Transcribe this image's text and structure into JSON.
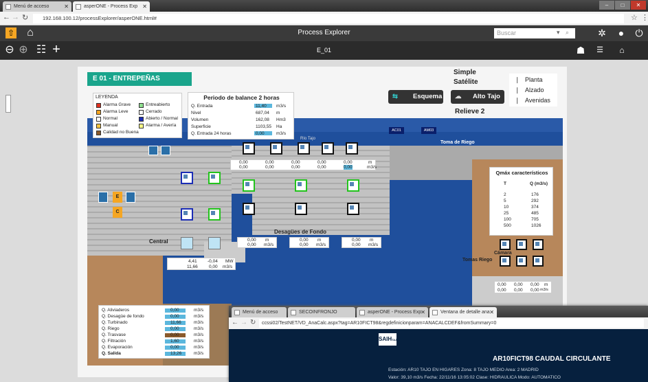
{
  "browser": {
    "tabs": [
      {
        "label": "Menú de acceso"
      },
      {
        "label": "asperONE - Process Exp"
      }
    ],
    "url": "192.168.100.12/processExplorer/asperONE.html#"
  },
  "app": {
    "title": "Process Explorer",
    "search_placeholder": "Buscar",
    "screen_name": "E_01"
  },
  "station": {
    "title": "E 01 - ENTREPEÑAS"
  },
  "legend": {
    "title": "LEYENDA",
    "items": [
      {
        "label": "Alarma Grave",
        "color": "#e03020"
      },
      {
        "label": "Entreabierto",
        "color": "#8fe08f"
      },
      {
        "label": "Alarma Leve",
        "color": "#f5a623"
      },
      {
        "label": "Cerrado",
        "color": "#ffffff"
      },
      {
        "label": "Normal",
        "color": "#ffffff"
      },
      {
        "label": "Abierto / Normal",
        "color": "#1b2db5"
      },
      {
        "label": "Manual",
        "color": "#f5c542"
      },
      {
        "label": "Alarma / Avería",
        "color": "#ffff88"
      },
      {
        "label": "Calidad no Buena",
        "color": "#8b5a2b"
      }
    ]
  },
  "balance": {
    "title": "Periodo de balance 2 horas",
    "rows": [
      {
        "label": "Q. Entrada",
        "value": "11,40",
        "unit": "m3/s",
        "bar": true
      },
      {
        "label": "Nivel",
        "value": "687,04",
        "unit": "m"
      },
      {
        "label": "Volumen",
        "value": "162,08",
        "unit": "Hm3"
      },
      {
        "label": "Superficie",
        "value": "1103,55",
        "unit": "Ha"
      },
      {
        "label": "Q. Entrada 24 horas",
        "value": "0,00",
        "unit": "m3/s",
        "bar": true
      }
    ]
  },
  "views": {
    "simple": "Simple",
    "satelite": "Satélite",
    "esquema": "Esquema",
    "alto_tajo": "Alto Tajo",
    "relieve": "Relieve 2"
  },
  "layers": {
    "planta": "Planta",
    "alzado": "Alzado",
    "avenidas": "Avenidas"
  },
  "map_labels": {
    "rio_tajo": "Río Tajo",
    "toma_riego": "Toma de Riego",
    "desagues": "Desagües de Fondo",
    "central": "Central",
    "camara": "Cámara",
    "tomas_riego": "Tomas Riego",
    "ac01": "AC01",
    "am03": "AM03"
  },
  "gate_values": [
    {
      "a": "0,00",
      "b": "0,00"
    },
    {
      "a": "0,00",
      "b": "0,00"
    },
    {
      "a": "0,00",
      "b": "0,00"
    },
    {
      "a": "0,00",
      "b": "0,00"
    },
    {
      "a": "0,00",
      "b": "0,00"
    }
  ],
  "gate_units": {
    "a": "m",
    "b": "m3/s"
  },
  "fondo": [
    {
      "a": "0,00",
      "ua": "m",
      "b": "0,00",
      "ub": "m3/s"
    },
    {
      "a": "0,00",
      "ua": "m",
      "b": "0,00",
      "ub": "m3/s"
    },
    {
      "a": "0,00",
      "ua": "m",
      "b": "0,00",
      "ub": "m3/s"
    }
  ],
  "central_vals": {
    "v1": "4,41",
    "v2": "-0,04",
    "u1": "MW",
    "v3": "11,66",
    "v4": "0,00",
    "u2": "m3/s"
  },
  "qmax": {
    "title": "Qmáx característicos",
    "col1": "T",
    "col2": "Q (m3/s)",
    "rows": [
      {
        "t": "2",
        "q": "176"
      },
      {
        "t": "5",
        "q": "292"
      },
      {
        "t": "10",
        "q": "374"
      },
      {
        "t": "25",
        "q": "485"
      },
      {
        "t": "100",
        "q": "705"
      },
      {
        "t": "500",
        "q": "1026"
      }
    ]
  },
  "riego_vals": {
    "a": "0,00",
    "b": "0,00",
    "c": "0,00",
    "ua": "m",
    "d": "0,00",
    "e": "0,00",
    "f": "0,00",
    "ub": "m3/s"
  },
  "flows": [
    {
      "label": "Q. Aliviaderos",
      "value": "0,00",
      "unit": "m3/s"
    },
    {
      "label": "Q. Desagüe de fondo",
      "value": "0,00",
      "unit": "m3/s"
    },
    {
      "label": "Q. Turbinado",
      "value": "11,66",
      "unit": "m3/s"
    },
    {
      "label": "Q. Riego",
      "value": "0,00",
      "unit": "m3/s"
    },
    {
      "label": "Q. Trasvase",
      "value": "0,00",
      "unit": "m3/s"
    },
    {
      "label": "Q. Filtración",
      "value": "1,60",
      "unit": "m3/s"
    },
    {
      "label": "Q. Evaporación",
      "value": "0,00",
      "unit": "m3/s"
    },
    {
      "label": "Q. Salida",
      "value": "13,26",
      "unit": "m3/s"
    }
  ],
  "overlay": {
    "tabs": [
      {
        "label": "Menú de acceso"
      },
      {
        "label": "SECOINFRONJO"
      },
      {
        "label": "asperONE - Process Exp"
      },
      {
        "label": "Ventana de detalle ana"
      }
    ],
    "url": "ccssi02/TestNET/VD_AnaCalc.aspx?tag=AR10FICT98&regdefinicionparam=ANACALCDEF&fromSummary=0",
    "logo": "SAIH",
    "logo_sub": "TAJO",
    "heading": "AR10FICT98   CAUDAL CIRCULANTE",
    "line1": "Estación:  AR10 TAJO EN HIGARES     Zona:  8  TAJO MEDIO     Area:  2  MADRID",
    "line2": "Valor:  39,10 m3/s     Fecha:  22/11/16 13:05:02     Clase:  HIDRAULICA     Modo:  AUTOMATICO"
  }
}
